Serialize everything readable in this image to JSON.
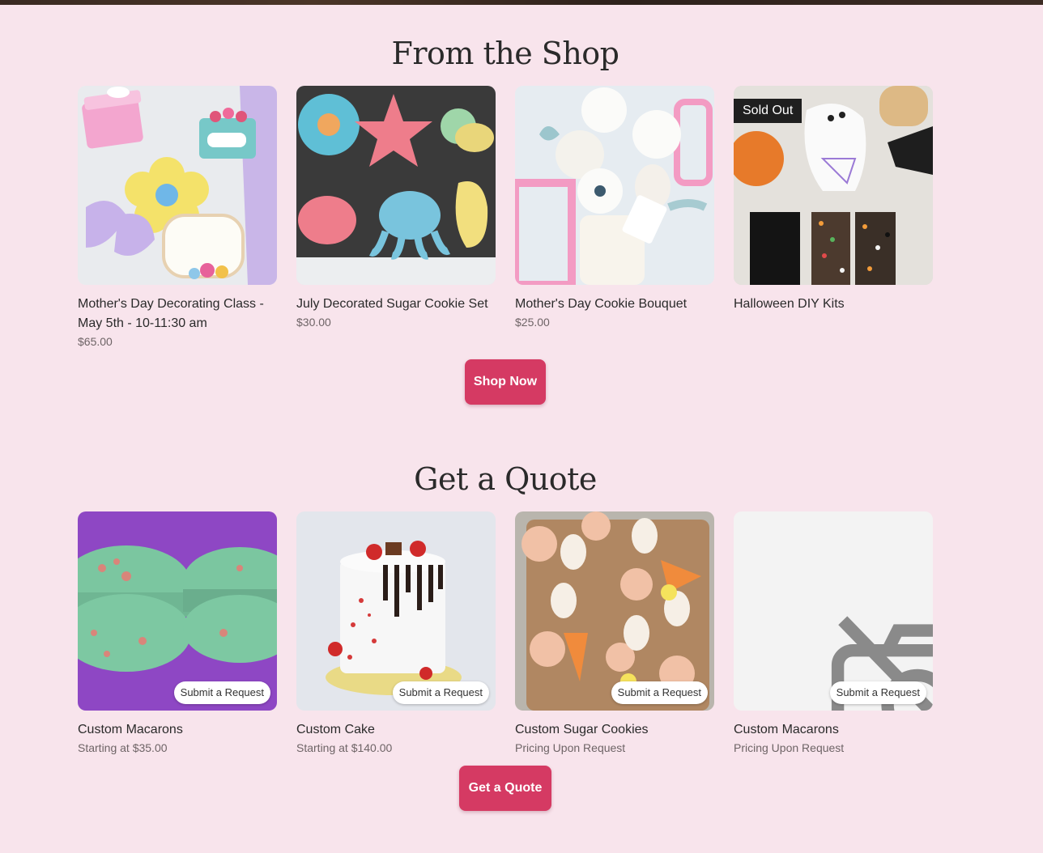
{
  "shop": {
    "title": "From the Shop",
    "products": [
      {
        "title": "Mother's Day Decorating Class - May 5th - 10-11:30 am",
        "price": "$65.00",
        "image": "mothers-day-cookies-photo"
      },
      {
        "title": "July Decorated Sugar Cookie Set",
        "price": "$30.00",
        "image": "sea-creature-cookies-photo"
      },
      {
        "title": "Mother's Day Cookie Bouquet",
        "price": "$25.00",
        "image": "flower-bouquet-cookies-photo"
      },
      {
        "title": "Halloween DIY Kits",
        "price": "",
        "badge": "Sold Out",
        "image": "halloween-kit-photo"
      }
    ],
    "cta_label": "Shop Now"
  },
  "quote": {
    "title": "Get a Quote",
    "items": [
      {
        "title": "Custom Macarons",
        "price": "Starting at $35.00",
        "pill": "Submit a Request",
        "image": "green-macarons-photo"
      },
      {
        "title": "Custom Cake",
        "price": "Starting at $140.00",
        "pill": "Submit a Request",
        "image": "drip-cake-photo"
      },
      {
        "title": "Custom Sugar Cookies",
        "price": "Pricing Upon Request",
        "pill": "Submit a Request",
        "image": "easter-cookies-photo"
      },
      {
        "title": "Custom Macarons",
        "price": "Pricing Upon Request",
        "pill": "Submit a Request",
        "image": "no-image-icon"
      }
    ],
    "cta_label": "Get a Quote"
  },
  "colors": {
    "page_background": "#f8e4ec",
    "accent": "#d53a63",
    "sold_out_badge": "#1f1f1f"
  }
}
